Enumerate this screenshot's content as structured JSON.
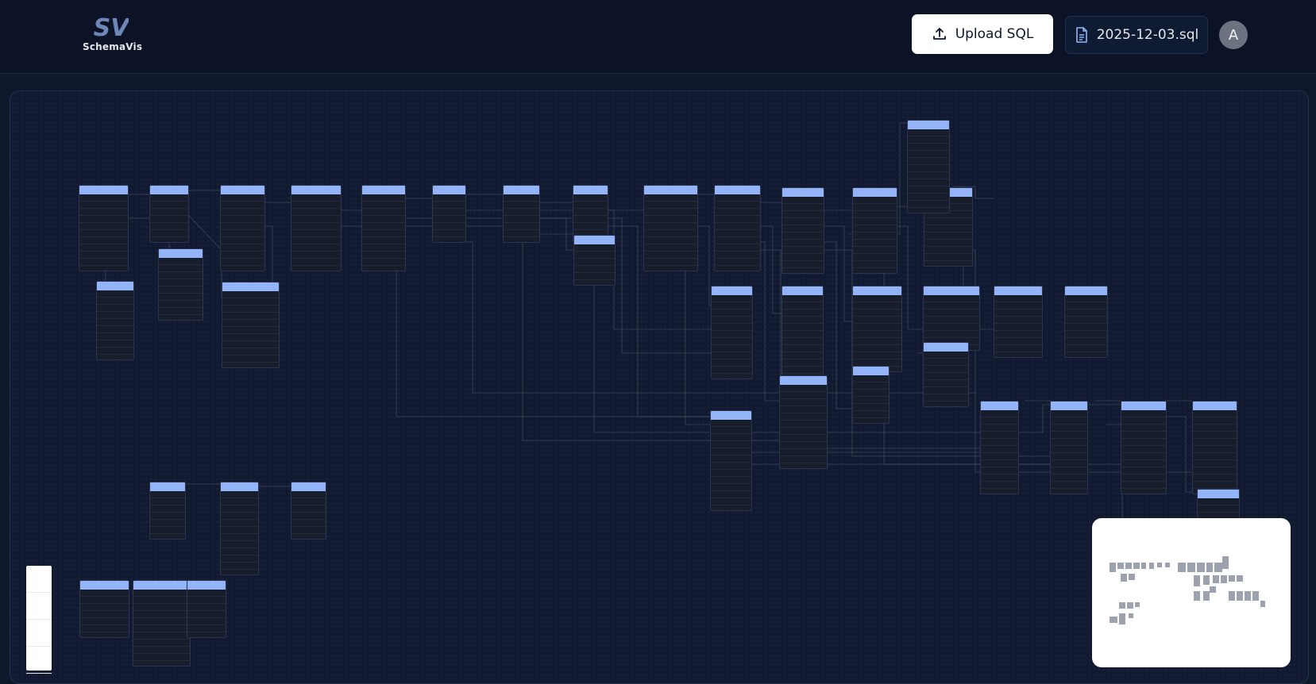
{
  "app": {
    "logo_mark": "SV",
    "name": "SchemaVis"
  },
  "header": {
    "upload_label": "Upload SQL",
    "upload_icon": "upload-icon",
    "file_icon": "file-icon",
    "file_name": "2025-12-03.sql",
    "avatar_initial": "A"
  },
  "canvas": {
    "table_header_color": "#93b4f8",
    "table_body_color": "#171d2b",
    "edge_color": "#4b5563",
    "minimap_node_color": "#9ca3af"
  }
}
